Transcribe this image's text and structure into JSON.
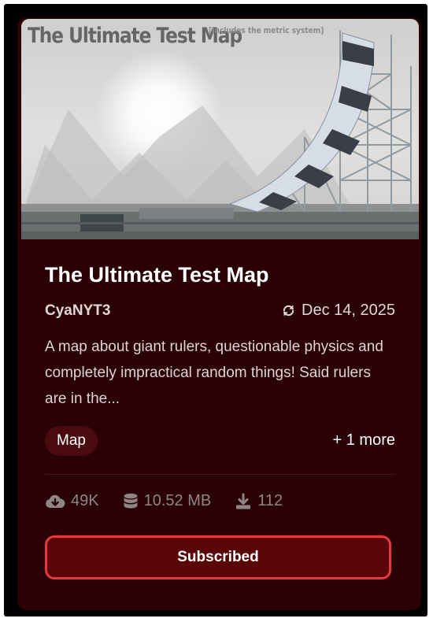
{
  "thumbnail": {
    "title_text": "The Ultimate Test Map",
    "subtitle_text": "[Includes the metric system]"
  },
  "card": {
    "title": "The Ultimate Test Map",
    "author": "CyaNYT3",
    "updated_icon": "refresh-icon",
    "date": "Dec 14, 2025",
    "description": "A map about giant rulers, questionable physics and completely impractical random things! Said rulers are in the...",
    "tag": "Map",
    "more_tags": "+ 1 more"
  },
  "stats": {
    "downloads_icon": "cloud-download-icon",
    "downloads": "49K",
    "size_icon": "database-icon",
    "size": "10.52 MB",
    "installs_icon": "download-icon",
    "installs": "112"
  },
  "action": {
    "label": "Subscribed"
  },
  "colors": {
    "card_background": "#2a0205",
    "button_border": "#e8373f",
    "button_background": "#5a0508"
  }
}
